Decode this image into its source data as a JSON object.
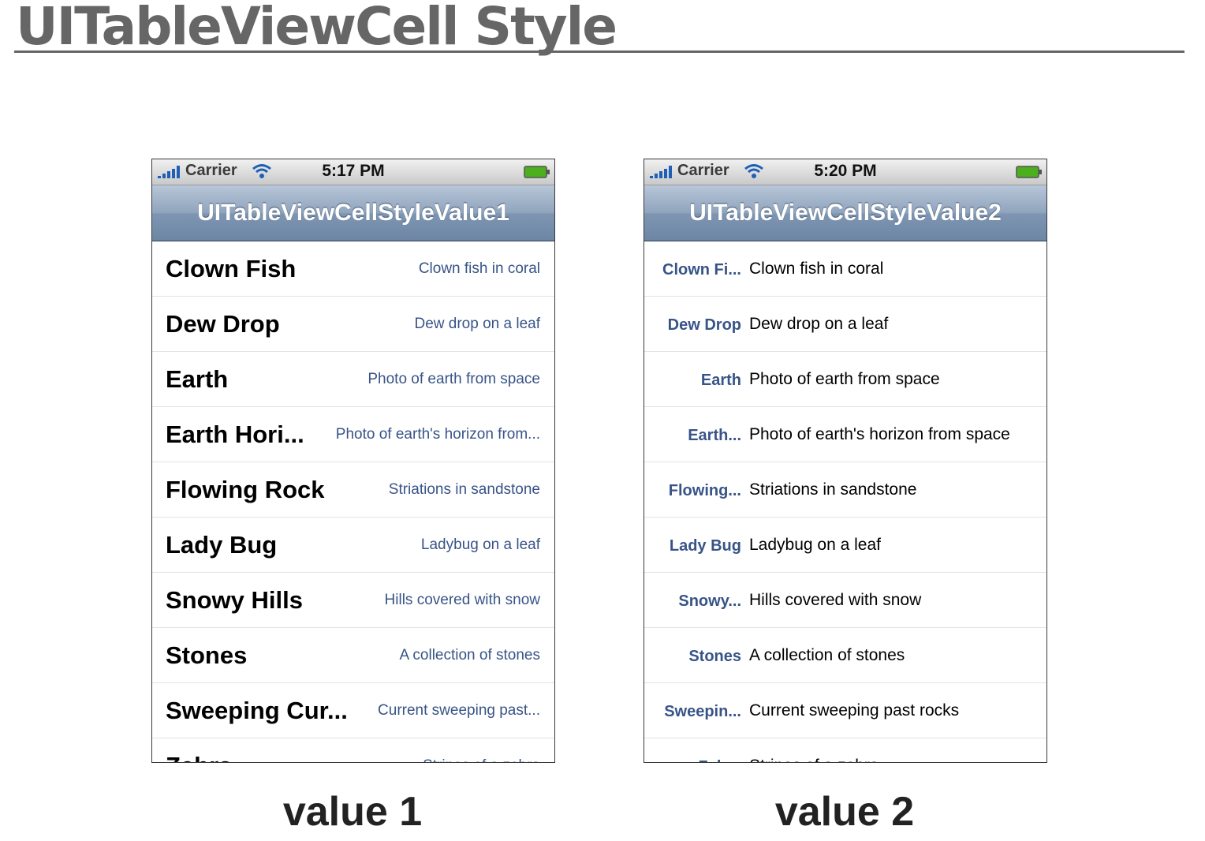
{
  "page": {
    "title": "UITableViewCell Style"
  },
  "phones": [
    {
      "caption": "value 1",
      "status": {
        "carrier": "Carrier",
        "time": "5:17 PM"
      },
      "nav_title": "UITableViewCellStyleValue1",
      "rows": [
        {
          "label": "Clown Fish",
          "detail": "Clown fish in coral"
        },
        {
          "label": "Dew Drop",
          "detail": "Dew drop on a leaf"
        },
        {
          "label": "Earth",
          "detail": "Photo of earth from space"
        },
        {
          "label": "Earth Hori...",
          "detail": "Photo of earth's horizon from..."
        },
        {
          "label": "Flowing Rock",
          "detail": "Striations in sandstone"
        },
        {
          "label": "Lady Bug",
          "detail": "Ladybug on a leaf"
        },
        {
          "label": "Snowy Hills",
          "detail": "Hills covered with snow"
        },
        {
          "label": "Stones",
          "detail": "A collection of stones"
        },
        {
          "label": "Sweeping Cur...",
          "detail": "Current sweeping past..."
        },
        {
          "label": "Zebra",
          "detail": "Stripes of a zebra"
        }
      ]
    },
    {
      "caption": "value 2",
      "status": {
        "carrier": "Carrier",
        "time": "5:20 PM"
      },
      "nav_title": "UITableViewCellStyleValue2",
      "rows": [
        {
          "label": "Clown Fi...",
          "detail": "Clown fish in coral"
        },
        {
          "label": "Dew Drop",
          "detail": "Dew drop on a leaf"
        },
        {
          "label": "Earth",
          "detail": "Photo of earth from space"
        },
        {
          "label": "Earth...",
          "detail": "Photo of earth's horizon from space"
        },
        {
          "label": "Flowing...",
          "detail": "Striations in sandstone"
        },
        {
          "label": "Lady Bug",
          "detail": "Ladybug on a leaf"
        },
        {
          "label": "Snowy...",
          "detail": "Hills covered with snow"
        },
        {
          "label": "Stones",
          "detail": "A collection of stones"
        },
        {
          "label": "Sweepin...",
          "detail": "Current sweeping past rocks"
        },
        {
          "label": "Zebra",
          "detail": "Stripes of a zebra"
        }
      ]
    }
  ],
  "icons": {
    "signal": "signal-bars-icon",
    "wifi": "wifi-icon",
    "battery": "battery-icon"
  },
  "colors": {
    "title": "#666666",
    "nav_bar": "#8fa4bd",
    "detail_blue": "#385487",
    "battery_green": "#4caf1e"
  }
}
